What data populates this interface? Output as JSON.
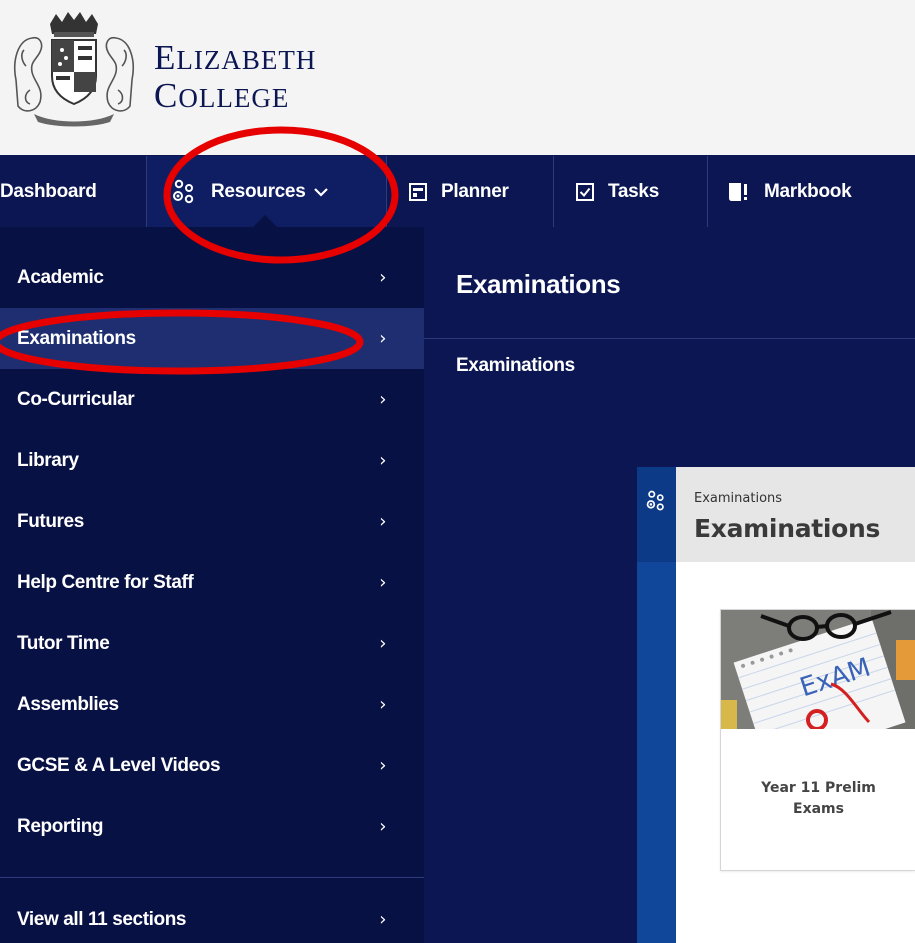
{
  "brand": {
    "line1_cap": "E",
    "line1_rest": "LIZABETH",
    "line2_cap": "C",
    "line2_rest": "OLLEGE"
  },
  "nav": {
    "dashboard": "Dashboard",
    "resources": "Resources",
    "planner": "Planner",
    "tasks": "Tasks",
    "markbook": "Markbook"
  },
  "menu": {
    "items": [
      {
        "label": "Academic"
      },
      {
        "label": "Examinations"
      },
      {
        "label": "Co-Curricular"
      },
      {
        "label": "Library"
      },
      {
        "label": "Futures"
      },
      {
        "label": "Help Centre for Staff"
      },
      {
        "label": "Tutor Time"
      },
      {
        "label": "Assemblies"
      },
      {
        "label": "GCSE & A Level Videos"
      },
      {
        "label": "Reporting"
      }
    ],
    "view_all": "View all 11 sections",
    "active_index": 1
  },
  "pane": {
    "title": "Examinations",
    "link": "Examinations"
  },
  "preview": {
    "breadcrumb": "Examinations",
    "title": "Examinations",
    "card_label_1": "Year 11 Prelim",
    "card_label_2": "Exams",
    "card_image_text": "ExAM"
  },
  "colors": {
    "navy": "#0b1652",
    "menu_bg": "#081143",
    "active": "#1e2e70",
    "annotation": "#e60000"
  }
}
